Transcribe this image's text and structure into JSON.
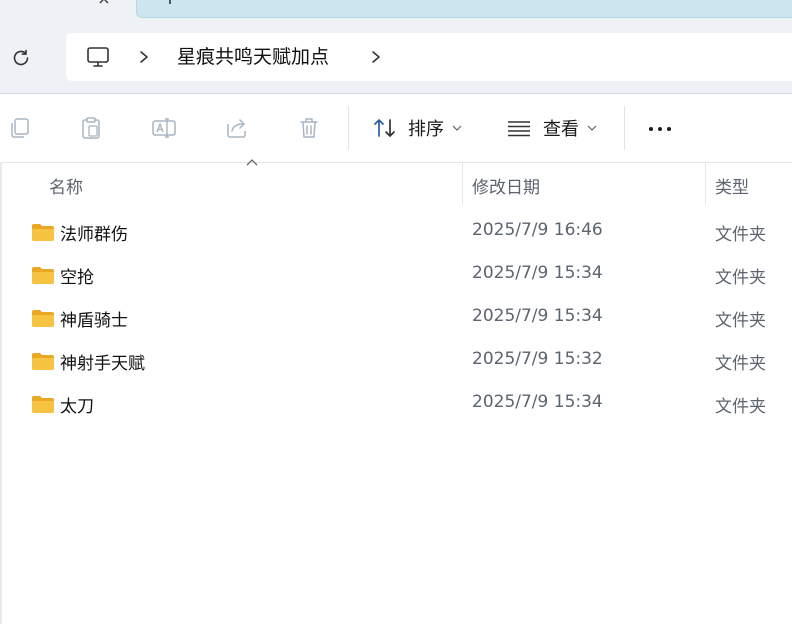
{
  "tabs": {
    "close_glyph": "×"
  },
  "address_bar": {
    "breadcrumb": [
      {
        "icon": "monitor-icon"
      },
      {
        "label": "星痕共鸣天赋加点"
      }
    ]
  },
  "command_bar": {
    "sort_label": "排序",
    "view_label": "查看"
  },
  "columns": {
    "name": "名称",
    "date": "修改日期",
    "type": "类型"
  },
  "files": [
    {
      "name": "法师群伤",
      "date": "2025/7/9 16:46",
      "type": "文件夹"
    },
    {
      "name": "空抢",
      "date": "2025/7/9 15:34",
      "type": "文件夹"
    },
    {
      "name": "神盾骑士",
      "date": "2025/7/9 15:34",
      "type": "文件夹"
    },
    {
      "name": "神射手天赋",
      "date": "2025/7/9 15:32",
      "type": "文件夹"
    },
    {
      "name": "太刀",
      "date": "2025/7/9 15:34",
      "type": "文件夹"
    }
  ],
  "colors": {
    "accent": "#2a5fa8",
    "folder": "#f6c343",
    "band": "#eef2f6"
  }
}
